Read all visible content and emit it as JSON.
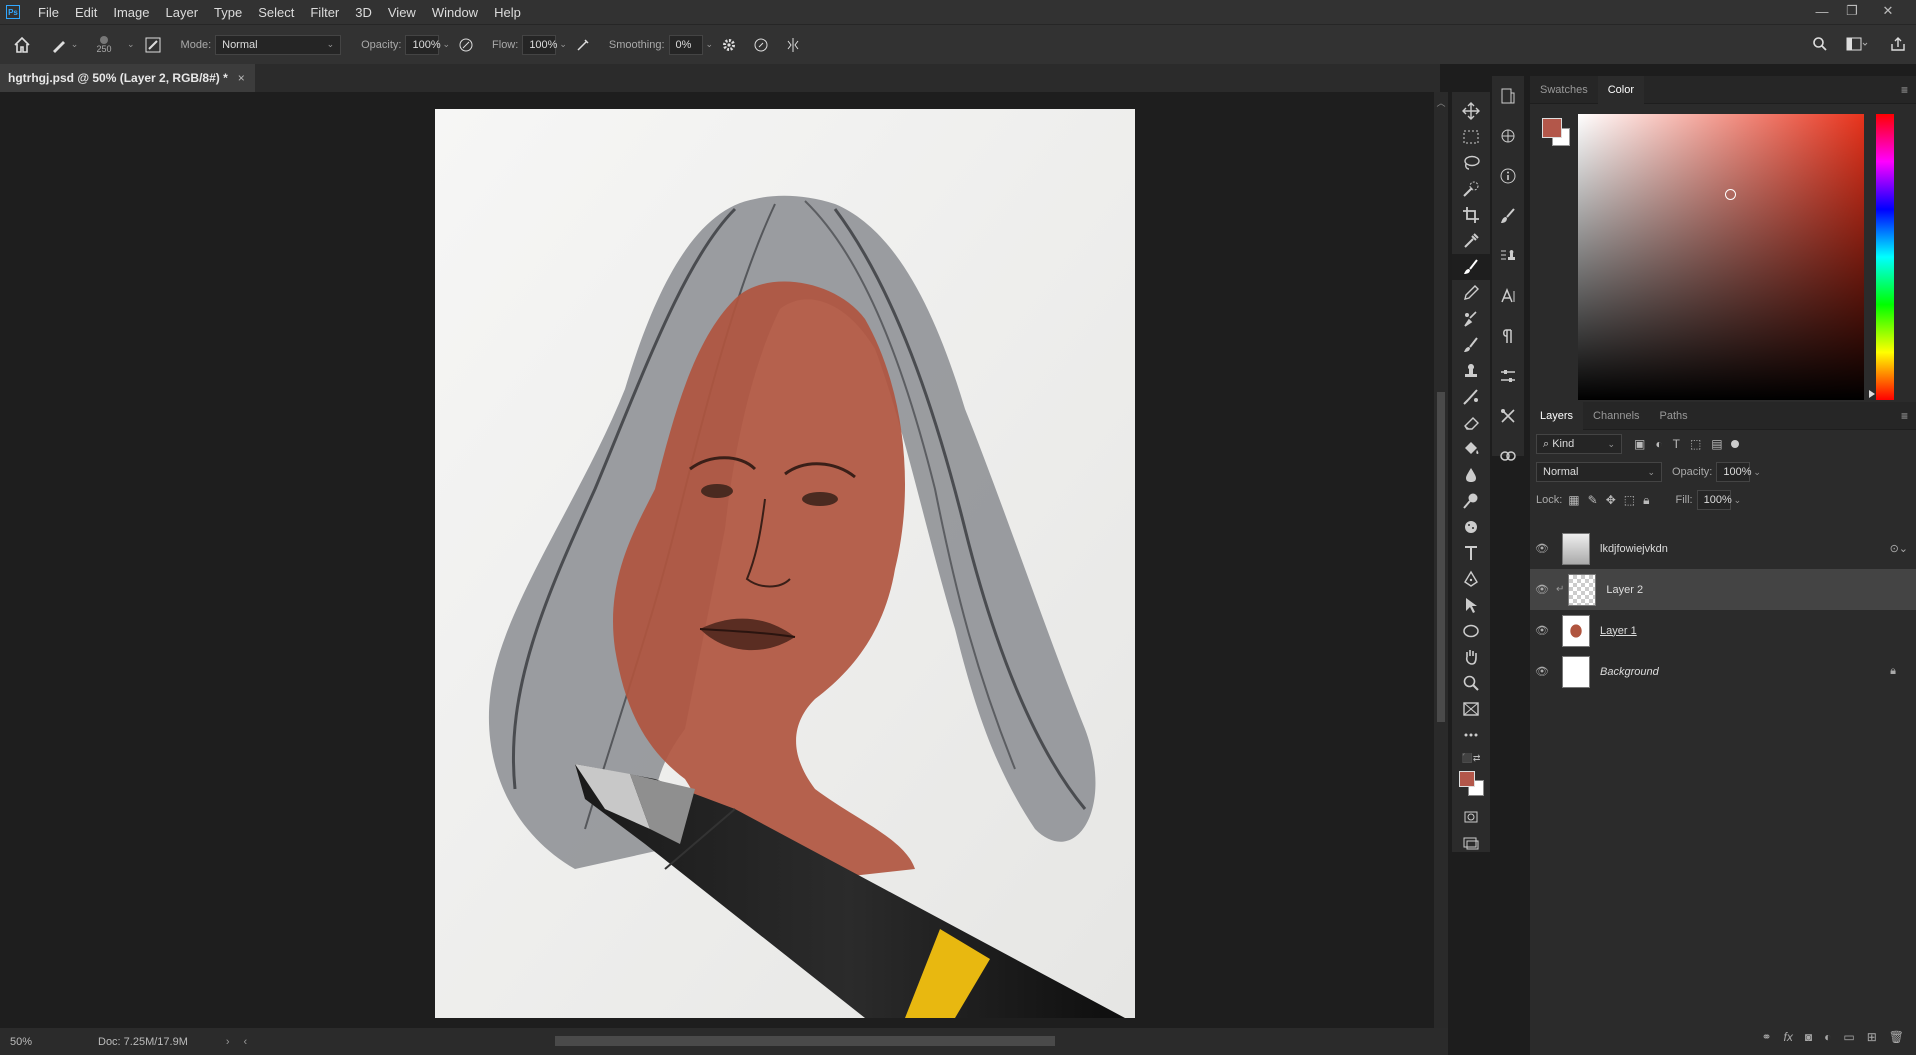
{
  "app": {
    "logo": "Ps"
  },
  "menu": [
    "File",
    "Edit",
    "Image",
    "Layer",
    "Type",
    "Select",
    "Filter",
    "3D",
    "View",
    "Window",
    "Help"
  ],
  "window_controls": {
    "minimize": "—",
    "restore": "❐",
    "close": "✕"
  },
  "options": {
    "brush_size": "250",
    "mode_label": "Mode:",
    "mode_value": "Normal",
    "opacity_label": "Opacity:",
    "opacity_value": "100%",
    "flow_label": "Flow:",
    "flow_value": "100%",
    "smoothing_label": "Smoothing:",
    "smoothing_value": "0%"
  },
  "document": {
    "tab_title": "hgtrhgj.psd @ 50% (Layer 2, RGB/8#) *",
    "close": "×"
  },
  "status": {
    "zoom": "50%",
    "doc_info": "Doc: 7.25M/17.9M"
  },
  "colors": {
    "foreground": "#b3574a",
    "background": "#ffffff",
    "skin_overlay": "#b0553f",
    "panel_bg": "#2b2b2b"
  },
  "color_panel": {
    "tabs": [
      "Swatches",
      "Color"
    ],
    "active_tab": "Color"
  },
  "layers_panel": {
    "tabs": [
      "Layers",
      "Channels",
      "Paths"
    ],
    "active_tab": "Layers",
    "filter_label": "Kind",
    "blend_mode": "Normal",
    "opacity_label": "Opacity:",
    "opacity_value": "100%",
    "lock_label": "Lock:",
    "fill_label": "Fill:",
    "fill_value": "100%",
    "layers": [
      {
        "name": "lkdjfowiejvkdn",
        "selected": false
      },
      {
        "name": "Layer 2",
        "selected": true
      },
      {
        "name": "Layer 1",
        "selected": false
      },
      {
        "name": "Background",
        "selected": false,
        "locked": true
      }
    ]
  },
  "tools": [
    "move",
    "marquee",
    "lasso",
    "quick-select",
    "crop",
    "eyedropper",
    "brush",
    "pencil",
    "clone",
    "history-brush",
    "stamp",
    "smudge-brush",
    "eraser",
    "paint-bucket",
    "blur",
    "dodge",
    "sponge",
    "type",
    "pen",
    "path-select",
    "ellipse",
    "hand",
    "zoom",
    "frame",
    "more"
  ]
}
